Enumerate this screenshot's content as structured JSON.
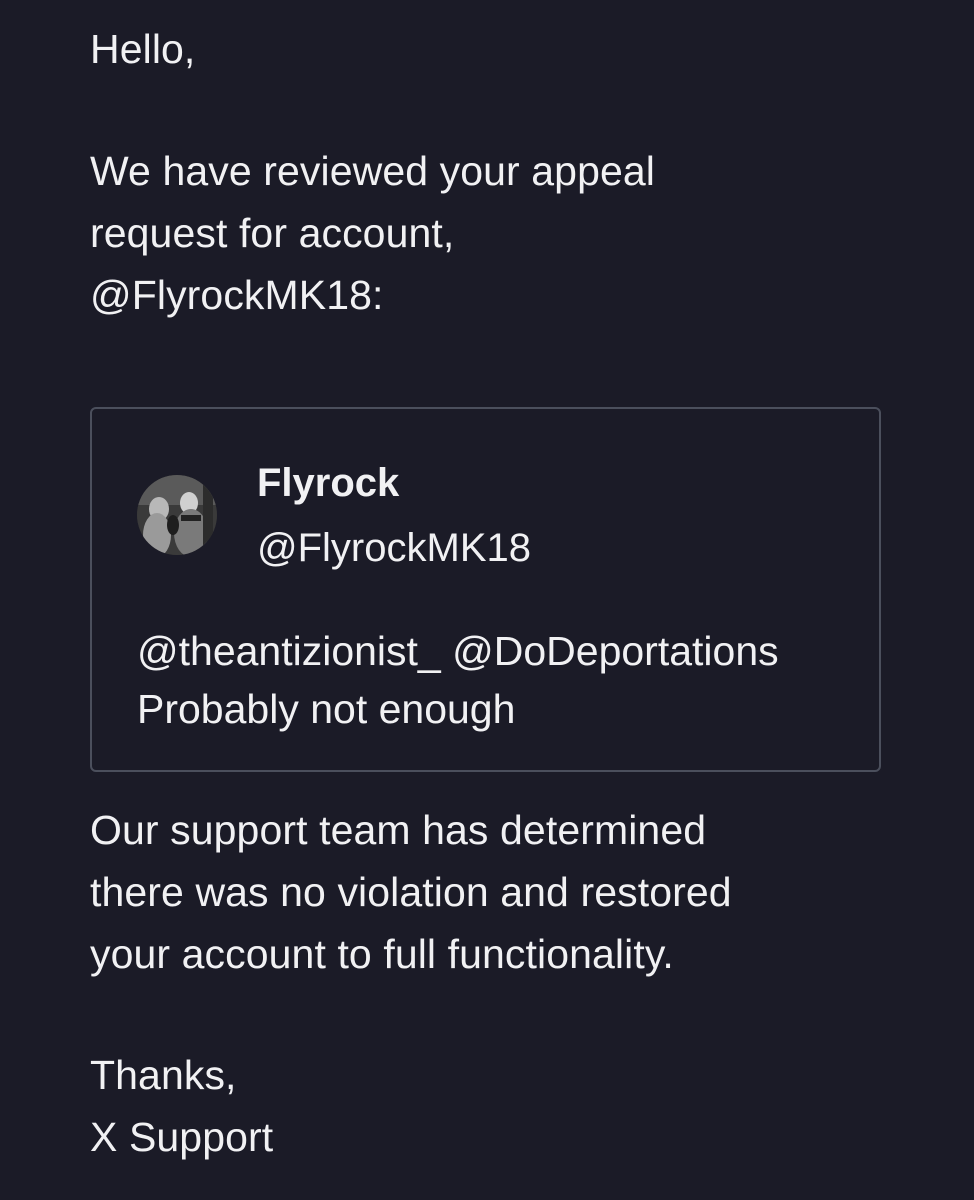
{
  "email": {
    "greeting": "Hello,",
    "intro_lines": [
      "We have reviewed your appeal",
      "request for account,",
      "@FlyrockMK18:"
    ],
    "tweet": {
      "avatar_icon": "profile-photo-avatar",
      "display_name": "Flyrock",
      "handle": "@FlyrockMK18",
      "mentions": "@theantizionist_ @DoDeportations",
      "text": "Probably not enough"
    },
    "result_lines": [
      "Our support team has determined",
      "there was no violation and restored",
      "your account to full functionality."
    ],
    "closing": "Thanks,",
    "signature": "X Support"
  },
  "colors": {
    "background": "#1b1b27",
    "text": "#f1f1f3",
    "card_border": "#4b4f5c"
  }
}
